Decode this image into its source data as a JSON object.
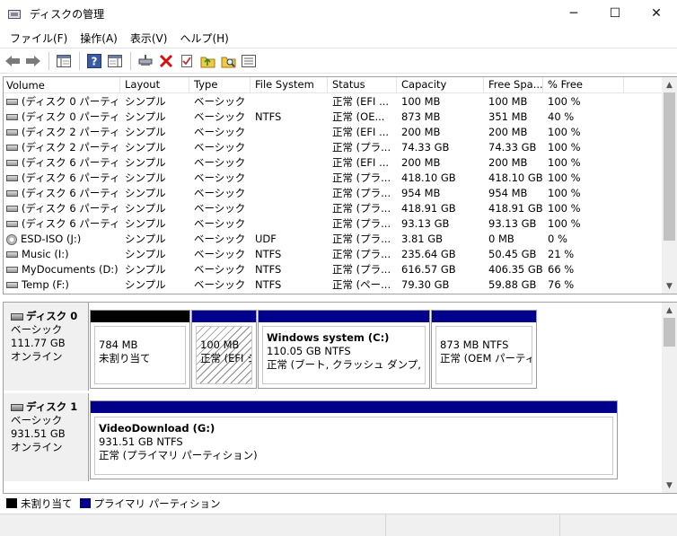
{
  "window": {
    "title": "ディスクの管理",
    "minimize": "─",
    "maximize": "☐",
    "close": "✕"
  },
  "menu": [
    "ファイル(F)",
    "操作(A)",
    "表示(V)",
    "ヘルプ(H)"
  ],
  "toolbar": {
    "icons": [
      "back-arrow-icon",
      "forward-arrow-icon",
      "console-tree-icon",
      "help-icon",
      "show-pane-icon",
      "connect-drive-icon",
      "delete-icon",
      "properties-icon",
      "open-folder-icon",
      "explore-icon",
      "list-view-icon"
    ]
  },
  "columns": [
    "Volume",
    "Layout",
    "Type",
    "File System",
    "Status",
    "Capacity",
    "Free Spa...",
    "% Free"
  ],
  "volumes": [
    {
      "icon": "drive",
      "name": "(ディスク 0 パーティシ...",
      "layout": "シンプル",
      "type": "ベーシック",
      "fs": "",
      "status": "正常 (EFI ...",
      "capacity": "100 MB",
      "free": "100 MB",
      "pct": "100 %"
    },
    {
      "icon": "drive",
      "name": "(ディスク 0 パーティシ...",
      "layout": "シンプル",
      "type": "ベーシック",
      "fs": "NTFS",
      "status": "正常 (OE...",
      "capacity": "873 MB",
      "free": "351 MB",
      "pct": "40 %"
    },
    {
      "icon": "drive",
      "name": "(ディスク 2 パーティシ...",
      "layout": "シンプル",
      "type": "ベーシック",
      "fs": "",
      "status": "正常 (EFI ...",
      "capacity": "200 MB",
      "free": "200 MB",
      "pct": "100 %"
    },
    {
      "icon": "drive",
      "name": "(ディスク 2 パーティシ...",
      "layout": "シンプル",
      "type": "ベーシック",
      "fs": "",
      "status": "正常 (プラ...",
      "capacity": "74.33 GB",
      "free": "74.33 GB",
      "pct": "100 %"
    },
    {
      "icon": "drive",
      "name": "(ディスク 6 パーティシ...",
      "layout": "シンプル",
      "type": "ベーシック",
      "fs": "",
      "status": "正常 (EFI ...",
      "capacity": "200 MB",
      "free": "200 MB",
      "pct": "100 %"
    },
    {
      "icon": "drive",
      "name": "(ディスク 6 パーティシ...",
      "layout": "シンプル",
      "type": "ベーシック",
      "fs": "",
      "status": "正常 (プラ...",
      "capacity": "418.10 GB",
      "free": "418.10 GB",
      "pct": "100 %"
    },
    {
      "icon": "drive",
      "name": "(ディスク 6 パーティシ...",
      "layout": "シンプル",
      "type": "ベーシック",
      "fs": "",
      "status": "正常 (プラ...",
      "capacity": "954 MB",
      "free": "954 MB",
      "pct": "100 %"
    },
    {
      "icon": "drive",
      "name": "(ディスク 6 パーティシ...",
      "layout": "シンプル",
      "type": "ベーシック",
      "fs": "",
      "status": "正常 (プラ...",
      "capacity": "418.91 GB",
      "free": "418.91 GB",
      "pct": "100 %"
    },
    {
      "icon": "drive",
      "name": "(ディスク 6 パーティシ...",
      "layout": "シンプル",
      "type": "ベーシック",
      "fs": "",
      "status": "正常 (プラ...",
      "capacity": "93.13 GB",
      "free": "93.13 GB",
      "pct": "100 %"
    },
    {
      "icon": "cd",
      "name": "ESD-ISO (J:)",
      "layout": "シンプル",
      "type": "ベーシック",
      "fs": "UDF",
      "status": "正常 (プラ...",
      "capacity": "3.81 GB",
      "free": "0 MB",
      "pct": "0 %"
    },
    {
      "icon": "drive",
      "name": "Music (I:)",
      "layout": "シンプル",
      "type": "ベーシック",
      "fs": "NTFS",
      "status": "正常 (プラ...",
      "capacity": "235.64 GB",
      "free": "50.45 GB",
      "pct": "21 %"
    },
    {
      "icon": "drive",
      "name": "MyDocuments (D:)",
      "layout": "シンプル",
      "type": "ベーシック",
      "fs": "NTFS",
      "status": "正常 (プラ...",
      "capacity": "616.57 GB",
      "free": "406.35 GB",
      "pct": "66 %"
    },
    {
      "icon": "drive",
      "name": "Temp (F:)",
      "layout": "シンプル",
      "type": "ベーシック",
      "fs": "NTFS",
      "status": "正常 (ペー...",
      "capacity": "79.30 GB",
      "free": "59.88 GB",
      "pct": "76 %"
    }
  ],
  "disks": [
    {
      "name": "ディスク 0",
      "type": "ベーシック",
      "size": "111.77 GB",
      "state": "オンライン",
      "partitions": [
        {
          "kind": "unallocated",
          "band": "#000000",
          "title": "",
          "line1": "784 MB",
          "line2": "未割り当て"
        },
        {
          "kind": "efi",
          "band": "#00008b",
          "title": "",
          "line1": "100 MB",
          "line2": "正常 (EFI シ"
        },
        {
          "kind": "primary",
          "band": "#00008b",
          "title": "Windows system  (C:)",
          "line1": "110.05 GB NTFS",
          "line2": "正常 (ブート, クラッシュ ダンプ, プライマ"
        },
        {
          "kind": "oem",
          "band": "#00008b",
          "title": "",
          "line1": "873 MB NTFS",
          "line2": "正常 (OEM パーティシ"
        }
      ]
    },
    {
      "name": "ディスク 1",
      "type": "ベーシック",
      "size": "931.51 GB",
      "state": "オンライン",
      "partitions": [
        {
          "kind": "primary",
          "band": "#00008b",
          "title": "VideoDownload  (G:)",
          "line1": "931.51 GB NTFS",
          "line2": "正常 (プライマリ パーティション)"
        }
      ]
    }
  ],
  "legend": [
    {
      "label": "未割り当て",
      "color": "#000000"
    },
    {
      "label": "プライマリ パーティション",
      "color": "#00008b"
    }
  ]
}
